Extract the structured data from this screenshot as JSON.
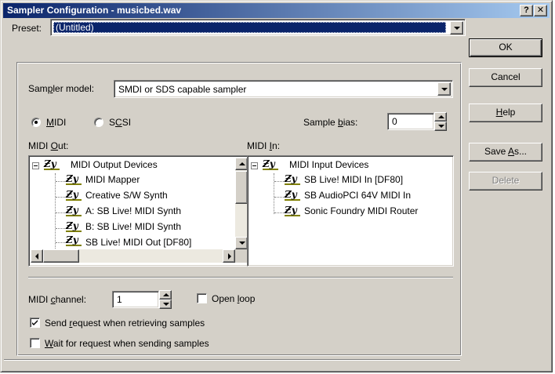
{
  "window": {
    "title": "Sampler Configuration - musicbed.wav",
    "help_glyph": "?",
    "close_glyph": "✕"
  },
  "preset": {
    "label": "Preset:",
    "value": "(Untitled)"
  },
  "buttons": {
    "ok": "OK",
    "cancel": "Cancel",
    "help": "Help",
    "save_as": "Save As...",
    "delete": "Delete"
  },
  "sampler_model": {
    "label": "Sampler model:",
    "value": "SMDI or SDS capable sampler"
  },
  "interface": {
    "midi_label": "MIDI",
    "scsi_label": "SCSI",
    "selected": "MIDI"
  },
  "sample_bias": {
    "label": "Sample bias:",
    "value": "0"
  },
  "midi_out": {
    "label": "MIDI Out:",
    "root": "MIDI Output Devices",
    "items": [
      "MIDI Mapper",
      "Creative S/W Synth",
      "A: SB Live! MIDI Synth",
      "B: SB Live! MIDI Synth",
      "SB Live! MIDI Out [DF80]"
    ]
  },
  "midi_in": {
    "label": "MIDI In:",
    "root": "MIDI Input Devices",
    "items": [
      "SB Live! MIDI In [DF80]",
      "SB AudioPCI 64V MIDI In",
      "Sonic Foundry MIDI Router"
    ]
  },
  "midi_channel": {
    "label": "MIDI channel:",
    "value": "1"
  },
  "options": {
    "open_loop": {
      "label": "Open loop",
      "checked": false
    },
    "send_request": {
      "label": "Send request when retrieving samples",
      "checked": true
    },
    "wait_request": {
      "label": "Wait for request when sending samples",
      "checked": false
    }
  },
  "colors": {
    "face": "#d4d0c8",
    "title_start": "#0a246a",
    "title_end": "#a6caf0",
    "selection": "#0a246a"
  }
}
